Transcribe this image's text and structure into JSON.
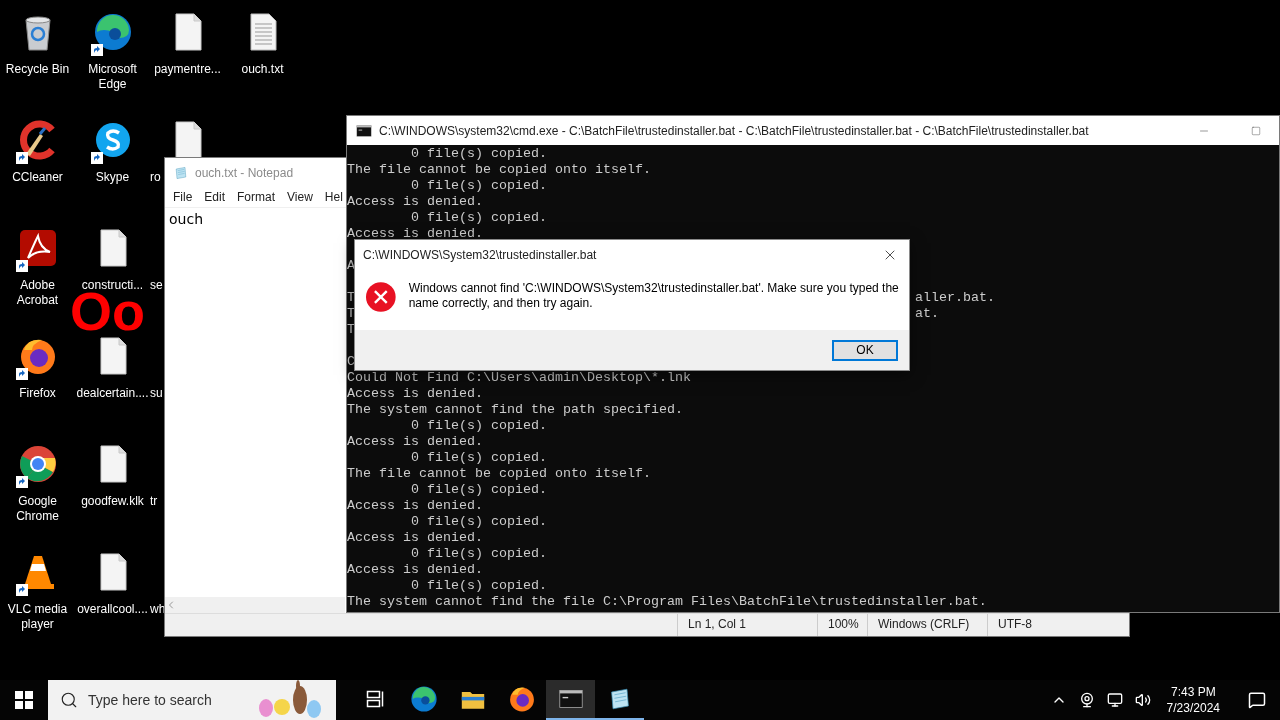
{
  "desktop": {
    "icons": [
      {
        "label": "Recycle Bin",
        "kind": "recycle",
        "shortcut": false,
        "clipped": false
      },
      {
        "label": "CCleaner",
        "kind": "ccleaner",
        "shortcut": true,
        "clipped": false
      },
      {
        "label": "Adobe Acrobat",
        "kind": "acrobat",
        "shortcut": true,
        "clipped": false
      },
      {
        "label": "Firefox",
        "kind": "firefox",
        "shortcut": true,
        "clipped": false
      },
      {
        "label": "Google Chrome",
        "kind": "chrome",
        "shortcut": true,
        "clipped": false
      },
      {
        "label": "VLC media player",
        "kind": "vlc",
        "shortcut": true,
        "clipped": false
      },
      {
        "label": "Microsoft Edge",
        "kind": "edge",
        "shortcut": true,
        "clipped": false
      },
      {
        "label": "Skype",
        "kind": "skype",
        "shortcut": true,
        "clipped": false
      },
      {
        "label": "constructi...",
        "kind": "file",
        "shortcut": false,
        "clipped": false
      },
      {
        "label": "dealcertain....",
        "kind": "file",
        "shortcut": false,
        "clipped": false
      },
      {
        "label": "goodfew.klk",
        "kind": "file",
        "shortcut": false,
        "clipped": false
      },
      {
        "label": "overallcool....",
        "kind": "file",
        "shortcut": false,
        "clipped": false
      },
      {
        "label": "paymentre...",
        "kind": "file",
        "shortcut": false,
        "clipped": false
      },
      {
        "label": "ro",
        "kind": "file",
        "shortcut": false,
        "clipped": true
      },
      {
        "label": "se",
        "kind": "hidden",
        "shortcut": false,
        "clipped": true
      },
      {
        "label": "su",
        "kind": "hidden",
        "shortcut": false,
        "clipped": true
      },
      {
        "label": "tr",
        "kind": "hidden",
        "shortcut": false,
        "clipped": true
      },
      {
        "label": "wh",
        "kind": "hidden",
        "shortcut": false,
        "clipped": true
      },
      {
        "label": "ouch.txt",
        "kind": "text",
        "shortcut": false,
        "clipped": false
      }
    ],
    "overlay_text": "Oo"
  },
  "notepad": {
    "title": "ouch.txt - Notepad",
    "menu": [
      "File",
      "Edit",
      "Format",
      "View",
      "Hel"
    ],
    "content": "ouch",
    "status": [
      "Ln 1, Col 1",
      "100%",
      "Windows (CRLF)",
      "UTF-8"
    ]
  },
  "console": {
    "title": "C:\\WINDOWS\\system32\\cmd.exe - C:\\BatchFile\\trustedinstaller.bat - C:\\BatchFile\\trustedinstaller.bat - C:\\BatchFile\\trustedinstaller.bat",
    "lines": [
      {
        "kind": "text",
        "text": "        0 file(s) copied."
      },
      {
        "kind": "text",
        "text": "The file cannot be copied onto itself."
      },
      {
        "kind": "text",
        "text": "        0 file(s) copied."
      },
      {
        "kind": "text",
        "text": "Access is denied."
      },
      {
        "kind": "text",
        "text": "        0 file(s) copied."
      },
      {
        "kind": "text",
        "text": "Access is denied."
      },
      {
        "kind": "blank"
      },
      {
        "kind": "text",
        "text": "A"
      },
      {
        "kind": "blank"
      },
      {
        "kind": "text",
        "text": "T",
        "tail": "aller.bat."
      },
      {
        "kind": "text",
        "text": "T",
        "tail": "at."
      },
      {
        "kind": "text",
        "text": "T"
      },
      {
        "kind": "blank"
      },
      {
        "kind": "text",
        "text": "C"
      },
      {
        "kind": "text",
        "text": "Could Not Find C:\\Users\\admin\\Desktop\\*.lnk"
      },
      {
        "kind": "text",
        "text": "Access is denied."
      },
      {
        "kind": "text",
        "text": "The system cannot find the path specified."
      },
      {
        "kind": "text",
        "text": "        0 file(s) copied."
      },
      {
        "kind": "text",
        "text": "Access is denied."
      },
      {
        "kind": "text",
        "text": "        0 file(s) copied."
      },
      {
        "kind": "text",
        "text": "The file cannot be copied onto itself."
      },
      {
        "kind": "text",
        "text": "        0 file(s) copied."
      },
      {
        "kind": "text",
        "text": "Access is denied."
      },
      {
        "kind": "text",
        "text": "        0 file(s) copied."
      },
      {
        "kind": "text",
        "text": "Access is denied."
      },
      {
        "kind": "text",
        "text": "        0 file(s) copied."
      },
      {
        "kind": "text",
        "text": "Access is denied."
      },
      {
        "kind": "text",
        "text": "        0 file(s) copied."
      },
      {
        "kind": "text",
        "text": "The system cannot find the file C:\\Program Files\\BatchFile\\trustedinstaller.bat."
      }
    ]
  },
  "dialog": {
    "title": "C:\\WINDOWS\\System32\\trustedinstaller.bat",
    "message": "Windows cannot find 'C:\\WINDOWS\\System32\\trustedinstaller.bat'. Make sure you typed the name correctly, and then try again.",
    "buttons": [
      {
        "label": "OK",
        "selected": true
      }
    ]
  },
  "taskbar": {
    "search": {
      "placeholder": "Type here to search"
    },
    "apps": [
      {
        "kind": "taskview",
        "running": false,
        "selected": false
      },
      {
        "kind": "edge",
        "running": false,
        "selected": false
      },
      {
        "kind": "explorer",
        "running": false,
        "selected": false
      },
      {
        "kind": "firefox",
        "running": false,
        "selected": false
      },
      {
        "kind": "cmd",
        "running": true,
        "selected": true
      },
      {
        "kind": "notepad",
        "running": true,
        "selected": false
      }
    ],
    "clock": {
      "time": "7:43 PM",
      "date": "7/23/2024"
    }
  }
}
